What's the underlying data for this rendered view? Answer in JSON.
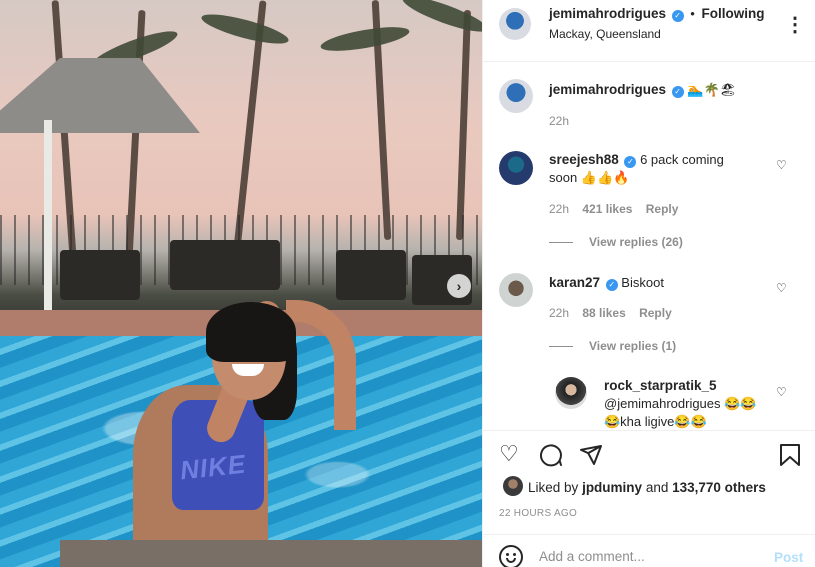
{
  "post": {
    "author": "jemimahrodrigues",
    "follow_state": "Following",
    "location": "Mackay, Queensland",
    "caption_emojis": "🏊🌴🏖",
    "caption_age": "22h"
  },
  "photo": {
    "shirt_text": "NIKE"
  },
  "comments": [
    {
      "user": "sreejesh88",
      "verified": true,
      "text": "6 pack coming soon 👍👍🔥",
      "age": "22h",
      "likes": "421 likes",
      "reply_label": "Reply",
      "view_replies": "View replies (26)"
    },
    {
      "user": "karan27",
      "verified": true,
      "text": "Biskoot",
      "age": "22h",
      "likes": "88 likes",
      "reply_label": "Reply",
      "view_replies": "View replies (1)"
    }
  ],
  "reply": {
    "user": "rock_starpratik_5",
    "text": "@jemimahrodrigues 😂😂😂kha ligive😂😂"
  },
  "actions": {
    "liked_by_prefix": "Liked by",
    "liked_by_user": "jpduminy",
    "liked_by_suffix": "and",
    "others": "133,770 others",
    "timestamp": "22 HOURS AGO"
  },
  "comment_box": {
    "placeholder": "Add a comment...",
    "post_label": "Post"
  },
  "icons": {
    "more": "more-options-icon",
    "verified": "verified-badge-icon",
    "heart": "heart-icon",
    "comment": "comment-icon",
    "share": "share-icon",
    "save": "bookmark-icon",
    "next": "chevron-right-icon",
    "emoji": "emoji-icon"
  },
  "colors": {
    "verified": "#3897f0",
    "post_disabled": "#b2dffc",
    "muted": "#8e8e8e"
  }
}
